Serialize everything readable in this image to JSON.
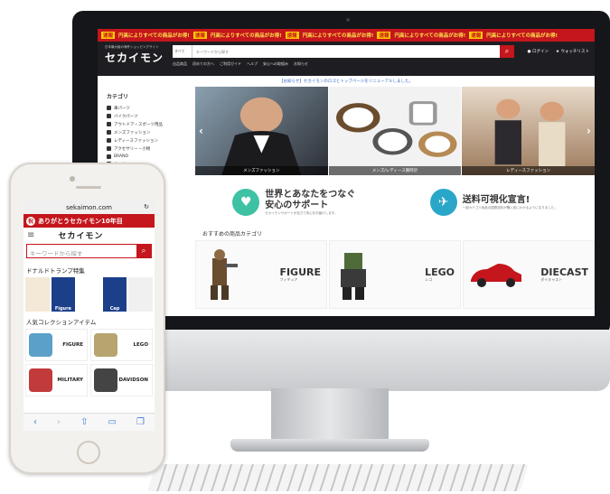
{
  "desktop": {
    "ticker": [
      {
        "tag": "速報",
        "text": "円高によりすべての商品がお得!"
      },
      {
        "tag": "速報",
        "text": "円高によりすべての商品がお得!"
      },
      {
        "tag": "速報",
        "text": "円高によりすべての商品がお得!"
      },
      {
        "tag": "速報",
        "text": "円高によりすべての商品がお得!"
      },
      {
        "tag": "速報",
        "text": "円高によりすべての商品がお得!"
      }
    ],
    "logo_sub": "日本最大級の海外ショッピングサイト",
    "logo": "セカイモン",
    "search_category": "すべて",
    "search_placeholder": "キーワードから探す",
    "subnav": [
      "出品商品",
      "初めての方へ",
      "ご利用ガイド",
      "ヘルプ",
      "安心への取組み",
      "お知らせ"
    ],
    "login_label": "ログイン",
    "watchlist_label": "ウォッチリスト",
    "notice": "【お知らせ】セカイモンのロゴとトップページをリニューアルしました。",
    "sidebar_title": "カテゴリ",
    "sidebar_items": [
      "車パーツ",
      "バイクパーツ",
      "アウトドア・スポーツ用品",
      "メンズファッション",
      "レディースファッション",
      "アクセサリー・小物",
      "BRAND",
      "ホーム"
    ],
    "hero": [
      "メンズファッション",
      "メンズ/レディース腕時計",
      "レディースファッション"
    ],
    "promo": [
      {
        "title1": "世界とあなたをつなぐ",
        "title2": "安心のサポート",
        "sub": "セカイモンサポートが全力で安心をお届けします。",
        "color": "#3fc1a4"
      },
      {
        "title1": "送料可視化宣言!",
        "title2": "",
        "sub": "一部カテゴリ商品の国際送料が購入前にわかるようになりました。",
        "color": "#2aa7c8"
      }
    ],
    "category_heading": "おすすめの商品カテゴリ",
    "categories": [
      {
        "name": "FIGURE",
        "sub": "フィギュア"
      },
      {
        "name": "LEGO",
        "sub": "レゴ"
      },
      {
        "name": "DIECAST",
        "sub": "ダイキャスト"
      }
    ]
  },
  "phone": {
    "url": "sekaimon.com",
    "banner": "ありがとうセカイモン10年目",
    "banner_badge": "祝",
    "logo": "セカイモン",
    "search_placeholder": "キーワードから探す",
    "section1": "ドナルドトランプ特集",
    "section1_tiles": [
      "",
      "Figure",
      "",
      "Cap",
      ""
    ],
    "section2": "人気コレクションアイテム",
    "collection": [
      {
        "name": "FIGURE"
      },
      {
        "name": "LEGO"
      },
      {
        "name": "MILITARY"
      },
      {
        "name": "HARLEY DAVIDSON"
      }
    ]
  }
}
